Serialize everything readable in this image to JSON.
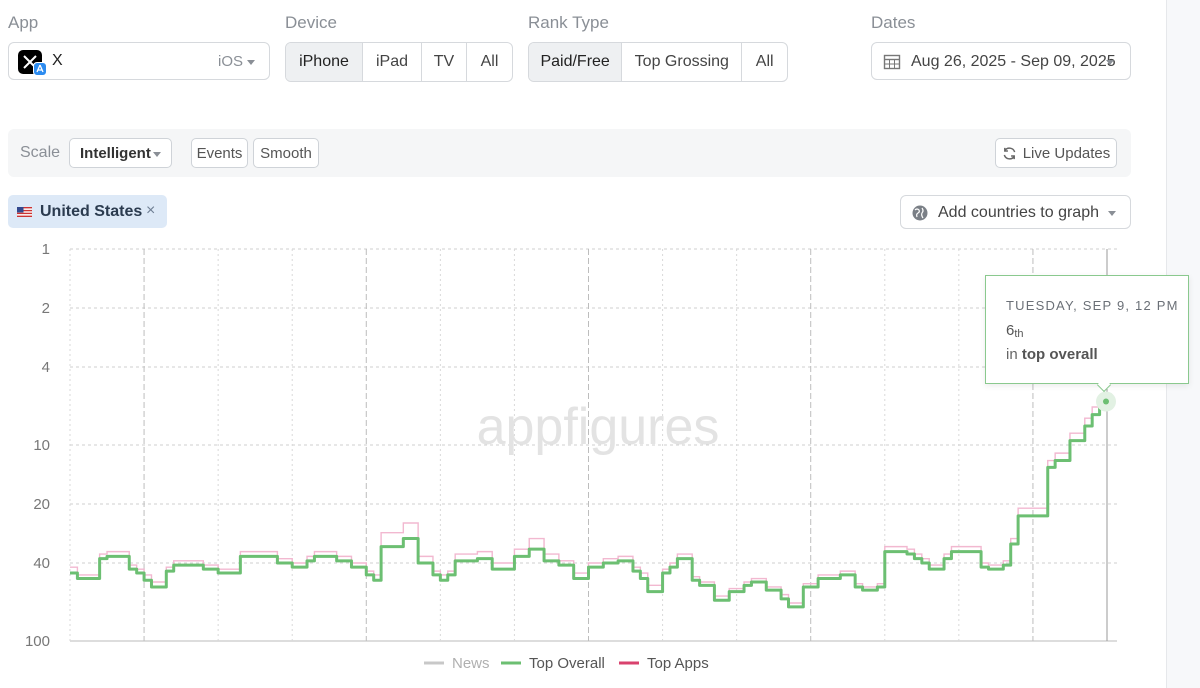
{
  "filters": {
    "app_label": "App",
    "device_label": "Device",
    "rank_type_label": "Rank Type",
    "dates_label": "Dates"
  },
  "app": {
    "name": "X",
    "platform": "iOS",
    "icon": "x-logo-icon"
  },
  "device_options": [
    "iPhone",
    "iPad",
    "TV",
    "All"
  ],
  "device_selected": "iPhone",
  "rank_type_options": [
    "Paid/Free",
    "Top Grossing",
    "All"
  ],
  "rank_type_selected": "Paid/Free",
  "date_range": "Aug 26, 2025 - Sep 09, 2025",
  "toolbar": {
    "scale_label": "Scale",
    "scale_value": "Intelligent",
    "events": "Events",
    "smooth": "Smooth",
    "live_updates": "Live Updates"
  },
  "country_chip": {
    "name": "United States",
    "remove": "×"
  },
  "add_countries": "Add countries to graph",
  "tooltip": {
    "date": "TUESDAY, SEP 9, 12 PM",
    "rank_num": "6",
    "rank_suffix": "th",
    "prefix": "in",
    "category": "top overall"
  },
  "colors": {
    "top_overall": "#6cbf72",
    "top_apps": "#f2b8d0",
    "news": "#c8c8c8",
    "top_apps_legend": "#d9426e",
    "grid": "#cfcfcf"
  },
  "chart_data": {
    "type": "line",
    "title": "",
    "watermark": "appfigures",
    "y_scale": "log",
    "y_inverted": true,
    "ylim": [
      1,
      100
    ],
    "y_ticks": [
      "1",
      "2",
      "4",
      "10",
      "20",
      "40",
      "100"
    ],
    "y_tick_values": [
      1,
      2,
      4,
      10,
      20,
      40,
      100
    ],
    "x_range": [
      "Aug 26, 2025",
      "Sep 09, 2025"
    ],
    "x_gridlines": 15,
    "legend": {
      "placement": "bottom",
      "entries": [
        "News",
        "Top Overall",
        "Top Apps"
      ]
    },
    "series": [
      {
        "name": "Top Overall",
        "step": true,
        "values": [
          45,
          48,
          48,
          48,
          38,
          37,
          37,
          37,
          43,
          45,
          49,
          53,
          53,
          44,
          41,
          41,
          41,
          41,
          43,
          43,
          45,
          45,
          45,
          37,
          37,
          37,
          37,
          37,
          40,
          40,
          42,
          42,
          39,
          37,
          37,
          37,
          39,
          39,
          42,
          42,
          46,
          49,
          33,
          33,
          33,
          30,
          30,
          40,
          40,
          46,
          49,
          46,
          39,
          39,
          39,
          38,
          38,
          43,
          43,
          43,
          37,
          37,
          34,
          34,
          39,
          39,
          41,
          41,
          48,
          48,
          42,
          42,
          40,
          40,
          39,
          39,
          44,
          48,
          56,
          56,
          45,
          42,
          38,
          38,
          49,
          52,
          52,
          62,
          62,
          56,
          56,
          52,
          50,
          50,
          55,
          55,
          61,
          67,
          67,
          53,
          53,
          48,
          48,
          48,
          46,
          46,
          53,
          55,
          55,
          53,
          35,
          35,
          35,
          36,
          38,
          40,
          43,
          43,
          38,
          35,
          35,
          35,
          35,
          42,
          43,
          43,
          41,
          32,
          23,
          23,
          23,
          23,
          13,
          12,
          12,
          9.5,
          9.5,
          8,
          7,
          6.2,
          6
        ]
      },
      {
        "name": "Top Apps",
        "step": true,
        "values": [
          42,
          46,
          46,
          46,
          36,
          35,
          35,
          35,
          41,
          43,
          46,
          50,
          50,
          42,
          39,
          39,
          39,
          39,
          41,
          41,
          43,
          43,
          43,
          35,
          35,
          35,
          35,
          35,
          38,
          38,
          40,
          40,
          37,
          35,
          35,
          35,
          37,
          37,
          40,
          40,
          44,
          46,
          28,
          28,
          28,
          25,
          25,
          37,
          37,
          44,
          46,
          44,
          36,
          36,
          36,
          35,
          35,
          40,
          40,
          40,
          34,
          34,
          30,
          30,
          36,
          36,
          39,
          39,
          45,
          45,
          40,
          40,
          38,
          38,
          37,
          37,
          42,
          45,
          52,
          52,
          43,
          40,
          36,
          36,
          47,
          50,
          50,
          59,
          59,
          54,
          54,
          50,
          48,
          48,
          53,
          53,
          58,
          64,
          64,
          51,
          51,
          46,
          46,
          46,
          44,
          44,
          51,
          53,
          53,
          51,
          33,
          33,
          33,
          34,
          36,
          38,
          41,
          41,
          36,
          33,
          33,
          33,
          33,
          40,
          41,
          41,
          39,
          30,
          21,
          21,
          21,
          21,
          12,
          11,
          11,
          8.7,
          8.7,
          7.3,
          6.4,
          5.8,
          5.6
        ]
      }
    ]
  }
}
